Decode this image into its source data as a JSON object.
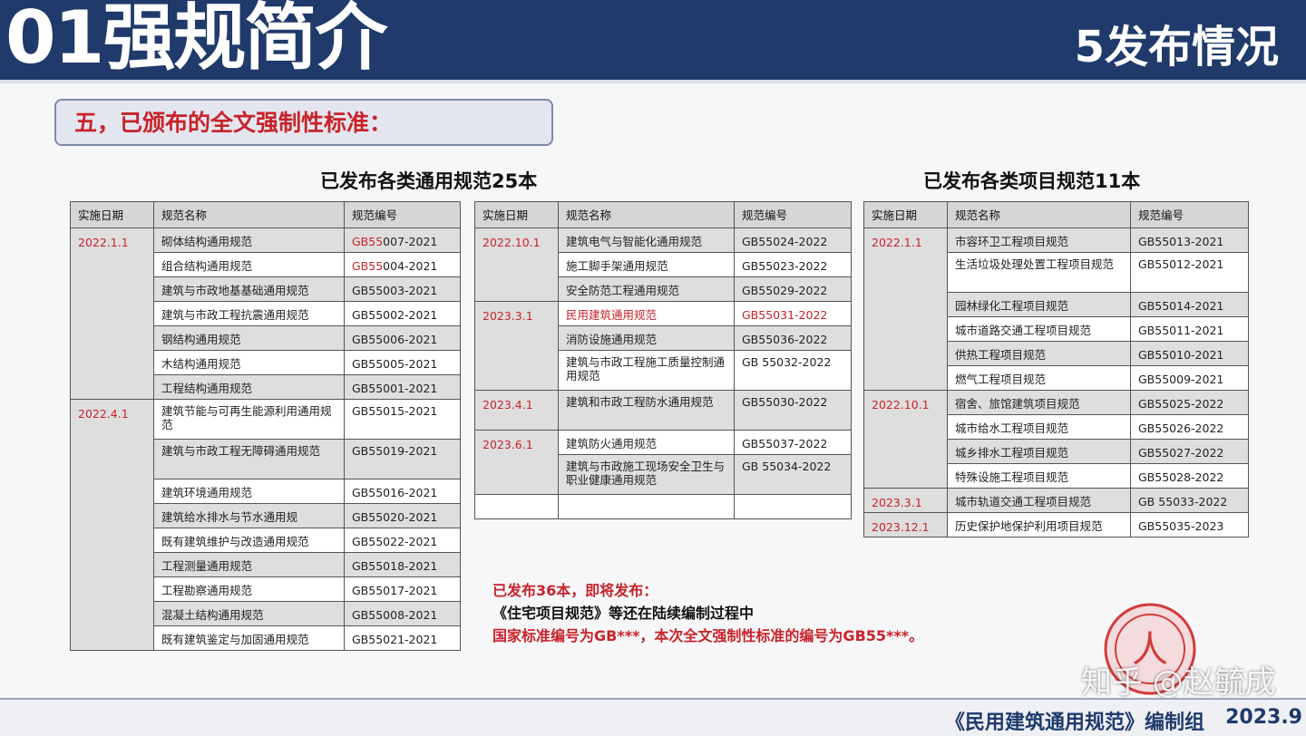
{
  "header": {
    "title": "01强规简介",
    "subtitle": "5发布情况"
  },
  "section": {
    "heading": "五，已颁布的全文强制性标准："
  },
  "general_block": {
    "title": "已发布各类通用规范25本",
    "headers": [
      "实施日期",
      "规范名称",
      "规范编号"
    ],
    "left_rows": [
      {
        "date": "2022.1.1",
        "name": "砌体结构通用规范",
        "code_red": "GB55",
        "code": "007-2021"
      },
      {
        "date": "",
        "name": "组合结构通用规范",
        "code_red": "GB55",
        "code": "004-2021"
      },
      {
        "date": "",
        "name": "建筑与市政地基基础通用规范",
        "code_red": "",
        "code": "GB55003-2021"
      },
      {
        "date": "",
        "name": "建筑与市政工程抗震通用规范",
        "code_red": "",
        "code": "GB55002-2021"
      },
      {
        "date": "",
        "name": "钢结构通用规范",
        "code_red": "",
        "code": "GB55006-2021"
      },
      {
        "date": "",
        "name": "木结构通用规范",
        "code_red": "",
        "code": "GB55005-2021"
      },
      {
        "date": "",
        "name": "工程结构通用规范",
        "code_red": "",
        "code": "GB55001-2021"
      },
      {
        "date": "2022.4.1",
        "name": "建筑节能与可再生能源利用通用规范",
        "code_red": "",
        "code": "GB55015-2021"
      },
      {
        "date": "",
        "name": "建筑与市政工程无障碍通用规范",
        "code_red": "",
        "code": "GB55019-2021"
      },
      {
        "date": "",
        "name": "建筑环境通用规范",
        "code_red": "",
        "code": "GB55016-2021"
      },
      {
        "date": "",
        "name": "建筑给水排水与节水通用规",
        "code_red": "",
        "code": "GB55020-2021"
      },
      {
        "date": "",
        "name": "既有建筑维护与改造通用规范",
        "code_red": "",
        "code": "GB55022-2021"
      },
      {
        "date": "",
        "name": "工程测量通用规范",
        "code_red": "",
        "code": "GB55018-2021"
      },
      {
        "date": "",
        "name": "工程勘察通用规范",
        "code_red": "",
        "code": "GB55017-2021"
      },
      {
        "date": "",
        "name": "混凝土结构通用规范",
        "code_red": "",
        "code": "GB55008-2021"
      },
      {
        "date": "",
        "name": "既有建筑鉴定与加固通用规范",
        "code_red": "",
        "code": "GB55021-2021"
      }
    ],
    "middle_rows": [
      {
        "date": "2022.10.1",
        "name": "建筑电气与智能化通用规范",
        "code": "GB55024-2022",
        "red": false
      },
      {
        "date": "",
        "name": "施工脚手架通用规范",
        "code": "GB55023-2022",
        "red": false
      },
      {
        "date": "",
        "name": "安全防范工程通用规范",
        "code": "GB55029-2022",
        "red": false
      },
      {
        "date": "2023.3.1",
        "name": "民用建筑通用规范",
        "code": "GB55031-2022",
        "red": true
      },
      {
        "date": "",
        "name": "消防设施通用规范",
        "code": "GB55036-2022",
        "red": false
      },
      {
        "date": "",
        "name": "建筑与市政工程施工质量控制通用规范",
        "code": "GB 55032-2022",
        "red": false
      },
      {
        "date": "2023.4.1",
        "name": "建筑和市政工程防水通用规范",
        "code": "GB55030-2022",
        "red": false
      },
      {
        "date": "2023.6.1",
        "name": "建筑防火通用规范",
        "code": "GB55037-2022",
        "red": false
      },
      {
        "date": "",
        "name": "建筑与市政施工现场安全卫生与职业健康通用规范",
        "code": "GB 55034-2022",
        "red": false
      },
      {
        "date": "",
        "name": "",
        "code": "",
        "red": false
      }
    ]
  },
  "project_block": {
    "title": "已发布各类项目规范11本",
    "headers": [
      "实施日期",
      "规范名称",
      "规范编号"
    ],
    "rows": [
      {
        "date": "2022.1.1",
        "name": "市容环卫工程项目规范",
        "code": "GB55013-2021"
      },
      {
        "date": "",
        "name": "生活垃圾处理处置工程项目规范",
        "code": "GB55012-2021"
      },
      {
        "date": "",
        "name": "园林绿化工程项目规范",
        "code": "GB55014-2021"
      },
      {
        "date": "",
        "name": "城市道路交通工程项目规范",
        "code": "GB55011-2021"
      },
      {
        "date": "",
        "name": "供热工程项目规范",
        "code": "GB55010-2021"
      },
      {
        "date": "",
        "name": "燃气工程项目规范",
        "code": "GB55009-2021"
      },
      {
        "date": "2022.10.1",
        "name": "宿舍、旅馆建筑项目规范",
        "code": "GB55025-2022"
      },
      {
        "date": "",
        "name": "城市给水工程项目规范",
        "code": "GB55026-2022"
      },
      {
        "date": "",
        "name": "城乡排水工程项目规范",
        "code": "GB55027-2022"
      },
      {
        "date": "",
        "name": "特殊设施工程项目规范",
        "code": "GB55028-2022"
      },
      {
        "date": "2023.3.1",
        "name": "城市轨道交通工程项目规范",
        "code": "GB 55033-2022"
      },
      {
        "date": "2023.12.1",
        "name": "历史保护地保护利用项目规范",
        "code": "GB55035-2023"
      }
    ]
  },
  "notes": {
    "line1": "已发布36本，即将发布：",
    "line2": "《住宅项目规范》等还在陆续编制过程中",
    "line3": "国家标准编号为GB***，本次全文强制性标准的编号为GB55***。"
  },
  "seal": {
    "glyph": "人"
  },
  "watermark": "知乎 @赵毓成",
  "footer": {
    "text": "《民用建筑通用规范》编制组",
    "date": "2023.9"
  },
  "colors": {
    "header_bg": "#1f3a6b",
    "accent_red": "#c8232a",
    "cell_gray": "#dedede"
  }
}
